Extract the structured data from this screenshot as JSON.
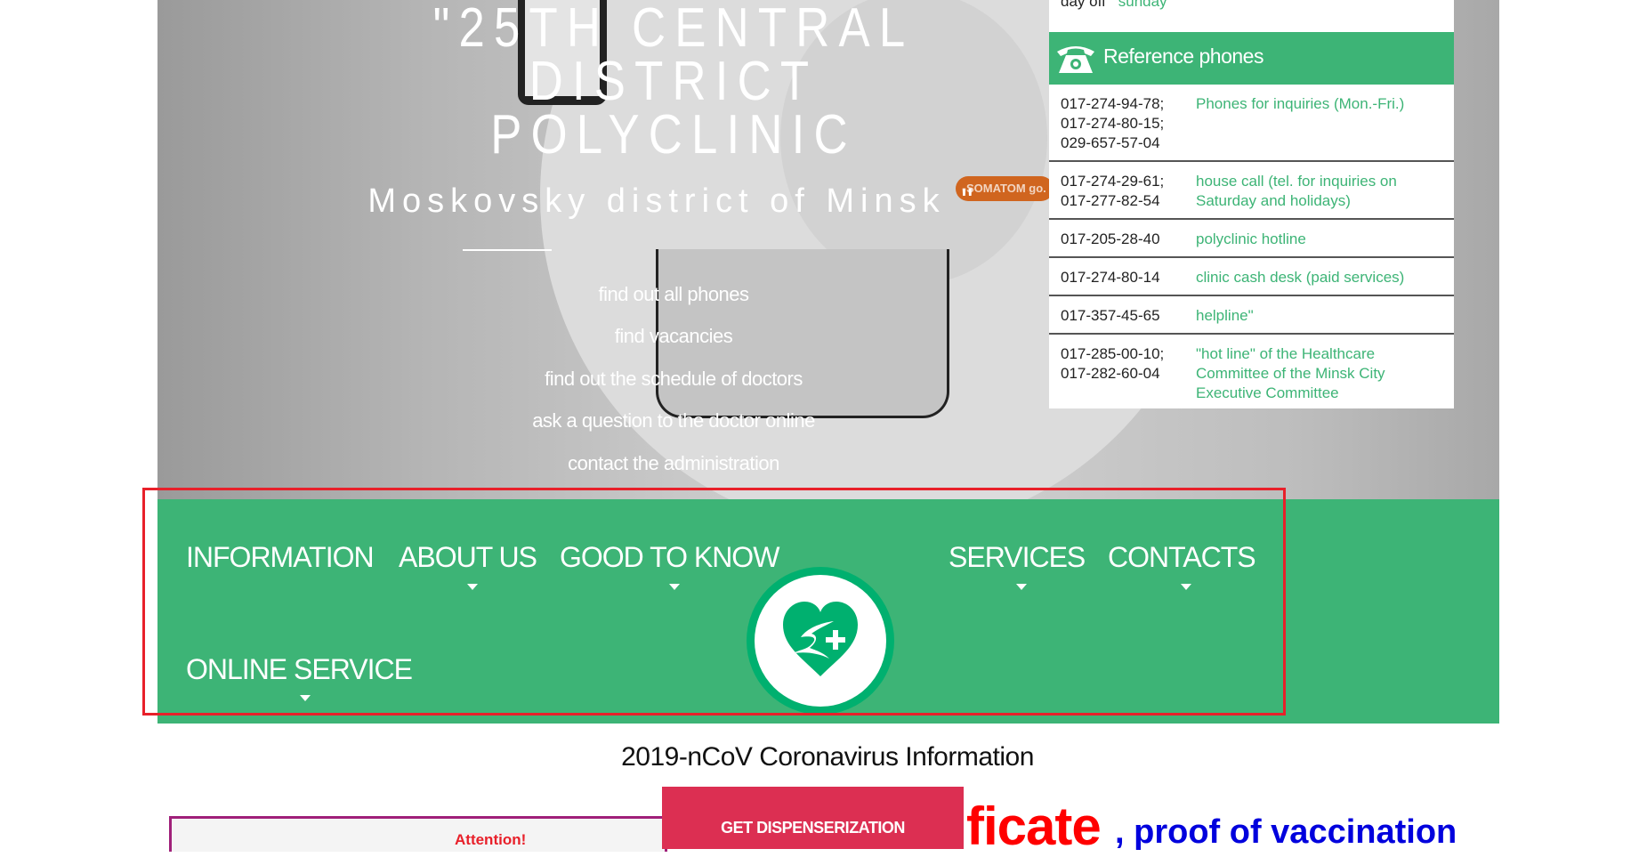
{
  "hero": {
    "title_lines": [
      "\"25TH CENTRAL",
      "DISTRICT",
      "POLYCLINIC"
    ],
    "subtitle": "Moskovsky district of Minsk \"",
    "links": [
      "find out all phones",
      "find vacancies",
      "find out the schedule of doctors",
      "ask a question to the doctor online",
      "contact the administration"
    ],
    "image_label": "SOMATOM go."
  },
  "phones_panel": {
    "day_off_label": "day off",
    "day_off_value": "sunday",
    "header_icon": "telephone-icon",
    "header": "Reference phones",
    "rows": [
      {
        "numbers": "017-274-94-78;\n017-274-80-15;\n029-657-57-04",
        "desc": "Phones for inquiries (Mon.-Fri.)"
      },
      {
        "numbers": "017-274-29-61;\n017-277-82-54",
        "desc": "house call (tel. for inquiries on Saturday and holidays)"
      },
      {
        "numbers": "017-205-28-40",
        "desc": "polyclinic hotline"
      },
      {
        "numbers": "017-274-80-14",
        "desc": "clinic cash desk (paid services)"
      },
      {
        "numbers": "017-357-45-65",
        "desc": "helpline\""
      },
      {
        "numbers": "017-285-00-10;\n017-282-60-04",
        "desc": "\"hot line\" of the Healthcare Committee of the Minsk City Executive Committee"
      }
    ]
  },
  "nav": {
    "items": [
      "INFORMATION",
      "ABOUT US",
      "GOOD TO KNOW",
      "SERVICES",
      "CONTACTS",
      "ONLINE SERVICE"
    ],
    "logo_icon": "heart-plus-logo-icon"
  },
  "main": {
    "covid_heading": "2019-nCoV Coronavirus Information",
    "attention": "Attention!",
    "dispensarization_button": "GET DISPENSERIZATION",
    "certificate_fragment": "ficate",
    "vaccination_text": ", proof of vaccination"
  },
  "colors": {
    "brand_green": "#3db476",
    "logo_green": "#00b06f",
    "highlight_red": "#e8202a",
    "button_red": "#dc2f52",
    "link_blue": "#0000dd"
  }
}
